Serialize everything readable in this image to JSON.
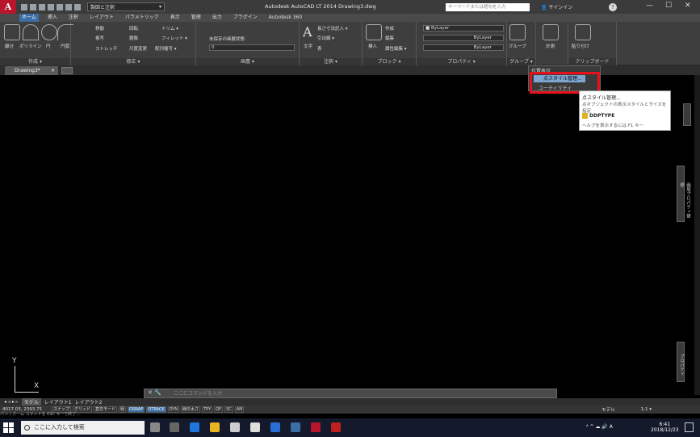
{
  "titlebar": {
    "logo": "A",
    "workspace": "製図と注釈",
    "title": "Autodesk AutoCAD LT 2014    Drawing3.dwg",
    "search_placeholder": "キーワードまたは語句を入力",
    "signin": "サインイン",
    "help": "?",
    "min": "—",
    "max": "☐",
    "close": "✕"
  },
  "menu": [
    "ホーム",
    "挿入",
    "注釈",
    "レイアウト",
    "パラメトリック",
    "表示",
    "管理",
    "出力",
    "プラグイン",
    "Autodesk 360"
  ],
  "ribbon": {
    "draw": {
      "title": "作成 ▾",
      "tools": [
        "線分",
        "ポリライン",
        "円",
        "円弧"
      ]
    },
    "modify": {
      "title": "修正 ▾",
      "tools": [
        "移動",
        "回転",
        "トリム ▾",
        "複写",
        "鏡像",
        "フィレット ▾",
        "ストレッチ",
        "尺度変更",
        "配列複写 ▾"
      ]
    },
    "layers": {
      "title": "画層 ▾",
      "state": "未保存の画層状態",
      "layer": "0"
    },
    "annotation": {
      "title": "注釈 ▾",
      "tools": [
        "文字",
        "長さ寸法記入 ▾",
        "引出線 ▾",
        "表"
      ]
    },
    "block": {
      "title": "ブロック ▾",
      "tools": [
        "挿入",
        "作成",
        "編集",
        "属性編集 ▾"
      ]
    },
    "properties": {
      "title": "プロパティ ▾",
      "color": "ByLayer",
      "linetype": "ByLayer",
      "lineweight": "ByLayer"
    },
    "groups": {
      "title": "グループ ▾",
      "tools": [
        "グループ"
      ]
    },
    "utilities": {
      "title": "",
      "tools": [
        "計測"
      ]
    },
    "clipboard": {
      "title": "クリップボード",
      "tools": [
        "貼り付け"
      ]
    }
  },
  "filetab": {
    "name": "Drawing3*",
    "close": "✕"
  },
  "dropdown": {
    "items": [
      "位置表示",
      "点スタイル管理...",
      "ユーティリティ"
    ]
  },
  "tooltip": {
    "title": "点スタイル管理...",
    "desc": "点オブジェクトの表示スタイルとサイズを指定",
    "command": "DDPTYPE",
    "help": "ヘルプを表示するには F1 キー"
  },
  "palettes": {
    "properties": "画層プロパティ管理",
    "props2": "プロパティ"
  },
  "ucs": {
    "x": "X",
    "y": "Y"
  },
  "command": {
    "placeholder": "ここにコマンドを入力"
  },
  "layout_tabs": [
    "モデル",
    "レイアウト1",
    "レイアウト2"
  ],
  "status": {
    "coords": "4017.03, 2393.75",
    "items": [
      "スナップ",
      "グリッド",
      "直交モード",
      "極",
      "OSNAP",
      "OTRACK",
      "DYN",
      "線の太さ",
      "TPY",
      "QP",
      "SC",
      "AM"
    ],
    "on_items": [
      "OSNAP",
      "OTRACK"
    ],
    "right_model": "モデル",
    "scale": "1:1 ▾"
  },
  "prompt": "パン / ズーム コマンドを ESC キーで終了...",
  "taskbar": {
    "search": "ここに入力して検索",
    "time": "6:41",
    "date": "2018/12/23",
    "tray": "ᴬ ^ ☁ 🔊 A"
  }
}
